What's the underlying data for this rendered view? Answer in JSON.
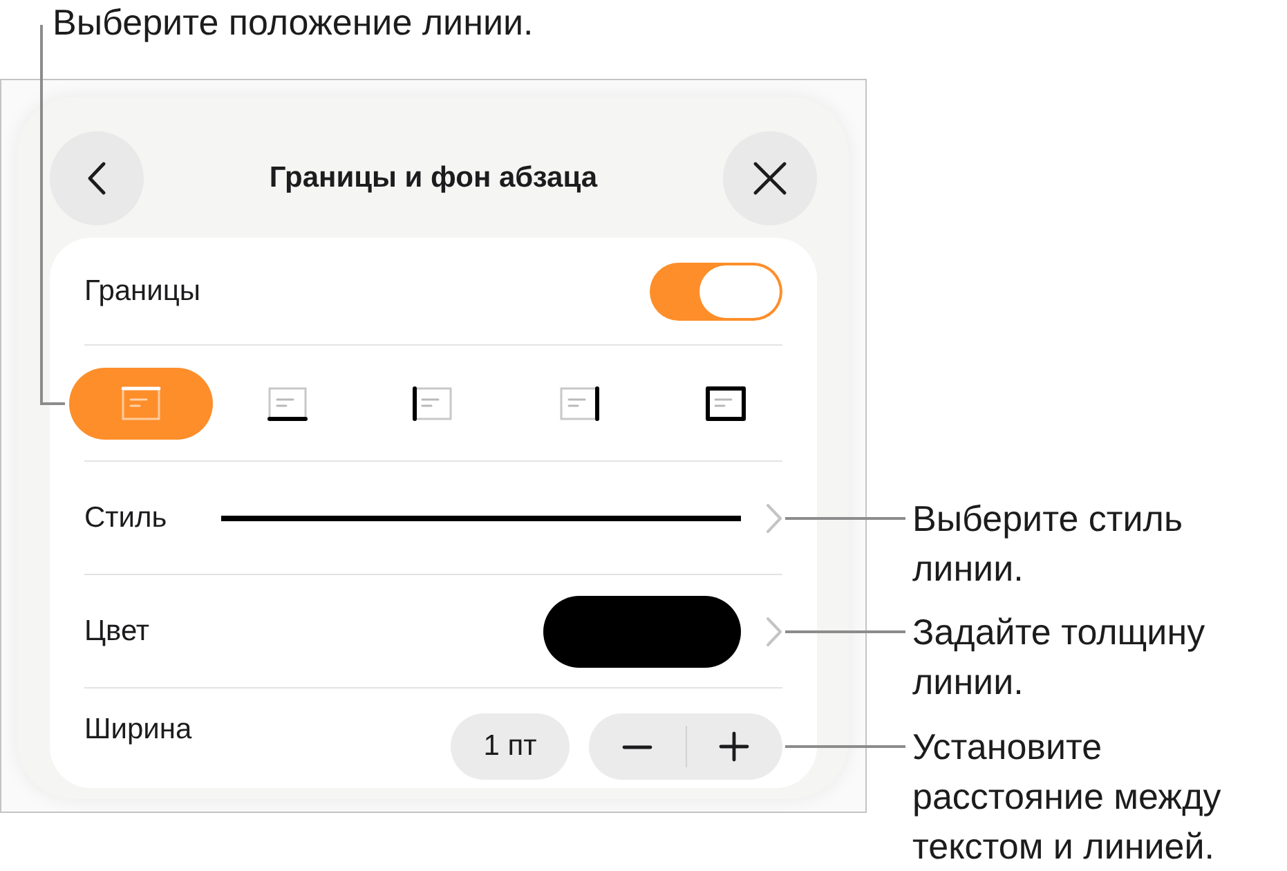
{
  "top_callout": {
    "text": "Выберите положение линии."
  },
  "panel": {
    "title": "Границы и фон абзаца",
    "borders": {
      "label": "Границы",
      "on": true
    },
    "positions": [
      {
        "kind": "top",
        "selected": true
      },
      {
        "kind": "bottom",
        "selected": false
      },
      {
        "kind": "left",
        "selected": false
      },
      {
        "kind": "right",
        "selected": false
      },
      {
        "kind": "box",
        "selected": false
      }
    ],
    "style": {
      "label": "Стиль"
    },
    "color": {
      "label": "Цвет",
      "color": "#000000"
    },
    "width": {
      "label": "Ширина",
      "value": "1 пт"
    }
  },
  "side_callouts": [
    {
      "text": "Выберите стиль линии."
    },
    {
      "text": "Задайте толщину линии."
    },
    {
      "text": "Установите расстояние между текстом и линией."
    }
  ]
}
